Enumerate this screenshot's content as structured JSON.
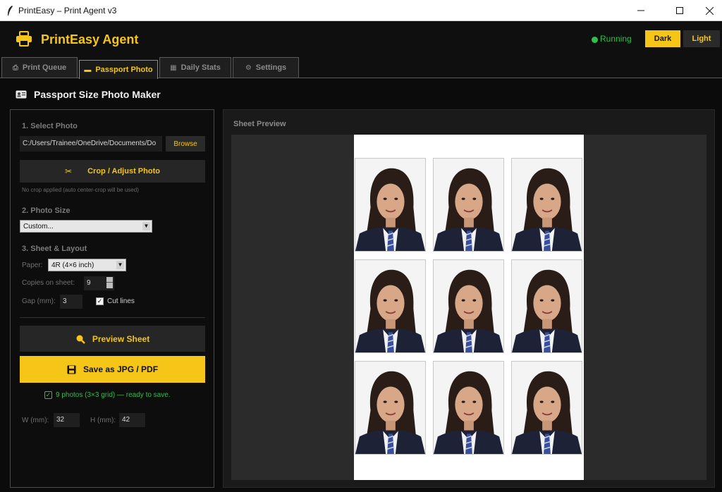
{
  "window": {
    "title": "PrintEasy – Print Agent v3"
  },
  "header": {
    "brand": "PrintEasy Agent",
    "status": "Running",
    "theme_dark": "Dark",
    "theme_light": "Light",
    "colors": {
      "accent": "#f5c518",
      "status": "#2fbf4a",
      "background": "#0b0b0b"
    }
  },
  "tabs": [
    {
      "label": "Print Queue",
      "icon": "printer-icon",
      "active": false
    },
    {
      "label": "Passport Photo",
      "icon": "id-card-icon",
      "active": true
    },
    {
      "label": "Daily Stats",
      "icon": "chart-icon",
      "active": false
    },
    {
      "label": "Settings",
      "icon": "gear-icon",
      "active": false
    }
  ],
  "page": {
    "title": "Passport Size Photo Maker"
  },
  "left": {
    "section1": "1. Select Photo",
    "path": "C:/Users/Trainee/OneDrive/Documents/Do",
    "browse": "Browse",
    "crop": "Crop / Adjust Photo",
    "crop_hint": "No crop applied (auto center-crop will be used)",
    "section2": "2. Photo Size",
    "photo_size": "Custom...",
    "section3": "3. Sheet & Layout",
    "paper_label": "Paper:",
    "paper": "4R (4×6 inch)",
    "copies_label": "Copies on sheet:",
    "copies": "9",
    "gap_label": "Gap (mm):",
    "gap": "3",
    "cut_lines": "Cut lines",
    "cut_lines_checked": true,
    "preview": "Preview Sheet",
    "save": "Save as JPG / PDF",
    "ready": "9 photos (3×3 grid) — ready to save.",
    "w_label": "W (mm):",
    "w": "32",
    "h_label": "H (mm):",
    "h": "42"
  },
  "preview": {
    "title": "Sheet Preview",
    "grid": {
      "rows": 3,
      "cols": 3
    }
  }
}
